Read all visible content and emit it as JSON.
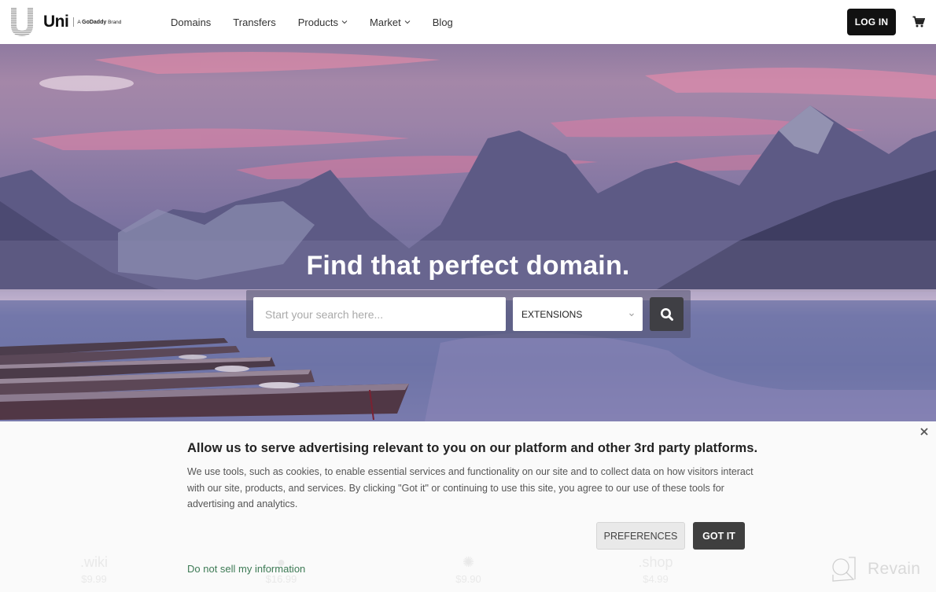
{
  "header": {
    "logo": {
      "wordmark": "Uni",
      "brand_prefix": "A",
      "brand_name": "GoDaddy",
      "brand_suffix": "Brand"
    },
    "nav": [
      {
        "label": "Domains",
        "has_dropdown": false
      },
      {
        "label": "Transfers",
        "has_dropdown": false
      },
      {
        "label": "Products",
        "has_dropdown": true
      },
      {
        "label": "Market",
        "has_dropdown": true
      },
      {
        "label": "Blog",
        "has_dropdown": false
      }
    ],
    "login_label": "LOG IN",
    "cart_icon": "cart-icon"
  },
  "hero": {
    "title": "Find that perfect domain.",
    "search": {
      "placeholder": "Start your search here...",
      "value": ""
    },
    "extensions_select": {
      "selected": "EXTENSIONS"
    },
    "search_button_icon": "search-icon"
  },
  "tlds": [
    {
      "name": ".wiki",
      "price": "$9.99"
    },
    {
      "name": "",
      "price": "$16.99"
    },
    {
      "name": "",
      "price": "$9.90"
    },
    {
      "name": ".shop",
      "price": "$4.99"
    }
  ],
  "cookie_banner": {
    "title": "Allow us to serve advertising relevant to you on our platform and other 3rd party platforms.",
    "body": "We use tools, such as cookies, to enable essential services and functionality on our site and to collect data on how visitors interact with our site, products, and services. By clicking \"Got it\" or continuing to use this site, you agree to our use of these tools for advertising and analytics.",
    "preferences_label": "PREFERENCES",
    "got_it_label": "GOT IT",
    "do_not_sell_label": "Do not sell my information",
    "close_icon": "close-icon"
  },
  "watermark": {
    "text": "Revain"
  },
  "colors": {
    "link_green": "#3d7a55",
    "dark_button": "#111111",
    "got_it_button": "#3f3f3f"
  }
}
